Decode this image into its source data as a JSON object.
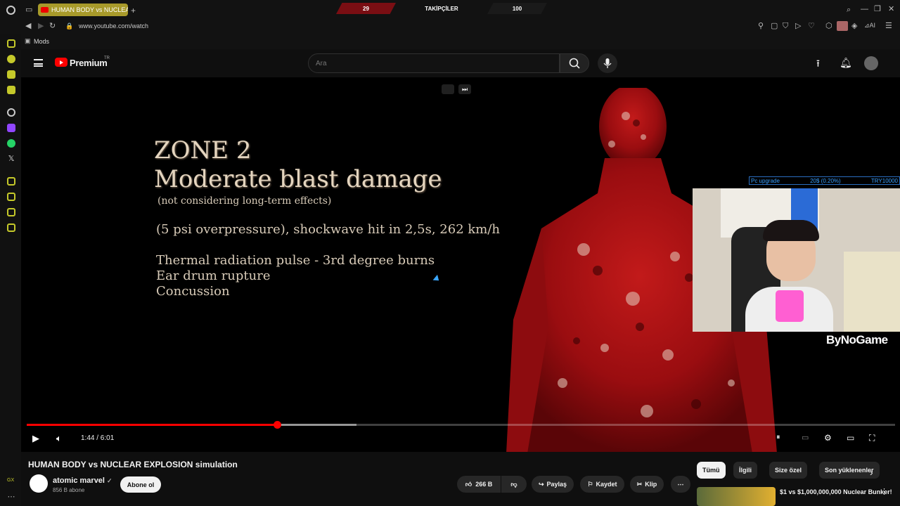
{
  "browser": {
    "tab_title": "HUMAN BODY vs NUCLEAR",
    "url": "www.youtube.com/watch",
    "bookmark": "Mods"
  },
  "stream_overlay": {
    "left_value": "29",
    "center_label": "TAKİPÇİLER",
    "right_value": "100"
  },
  "youtube": {
    "logo": "Premium",
    "logo_region": "TR",
    "search_placeholder": "Ara"
  },
  "slide": {
    "title_line1": "ZONE 2",
    "title_line2": "Moderate blast damage",
    "subtitle": "(not considering long-term effects)",
    "line1": "(5 psi overpressure), shockwave hit in 2,5s, 262 km/h",
    "bullets": [
      "Thermal radiation pulse - 3rd degree burns",
      "Ear drum rupture",
      "Concussion"
    ]
  },
  "donation_goal": {
    "label": "Pc upgrade",
    "progress_text": "20$ (0.20%)",
    "target": "TRY10000"
  },
  "watermark": "ByNoGame",
  "player": {
    "current_time": "1:44",
    "duration": "6:01",
    "time_display": "1:44 / 6:01",
    "played_fraction": 0.288,
    "buffered_fraction": 0.38
  },
  "video": {
    "title": "HUMAN BODY vs NUCLEAR EXPLOSION simulation",
    "channel": "atomic marvel",
    "subscribers": "856 B abone",
    "subscribe_label": "Abone ol",
    "likes": "266 B",
    "share": "Paylaş",
    "save": "Kaydet",
    "clip": "Klip"
  },
  "chips": [
    "Tümü",
    "İlgili",
    "Size özel",
    "Son yüklenenler"
  ],
  "recommendation": {
    "title": "$1 vs $1,000,000,000 Nuclear Bunker!"
  },
  "colors": {
    "accent": "#ff0000",
    "background": "#0f0f0f",
    "slide_text": "#e4d5bf"
  }
}
